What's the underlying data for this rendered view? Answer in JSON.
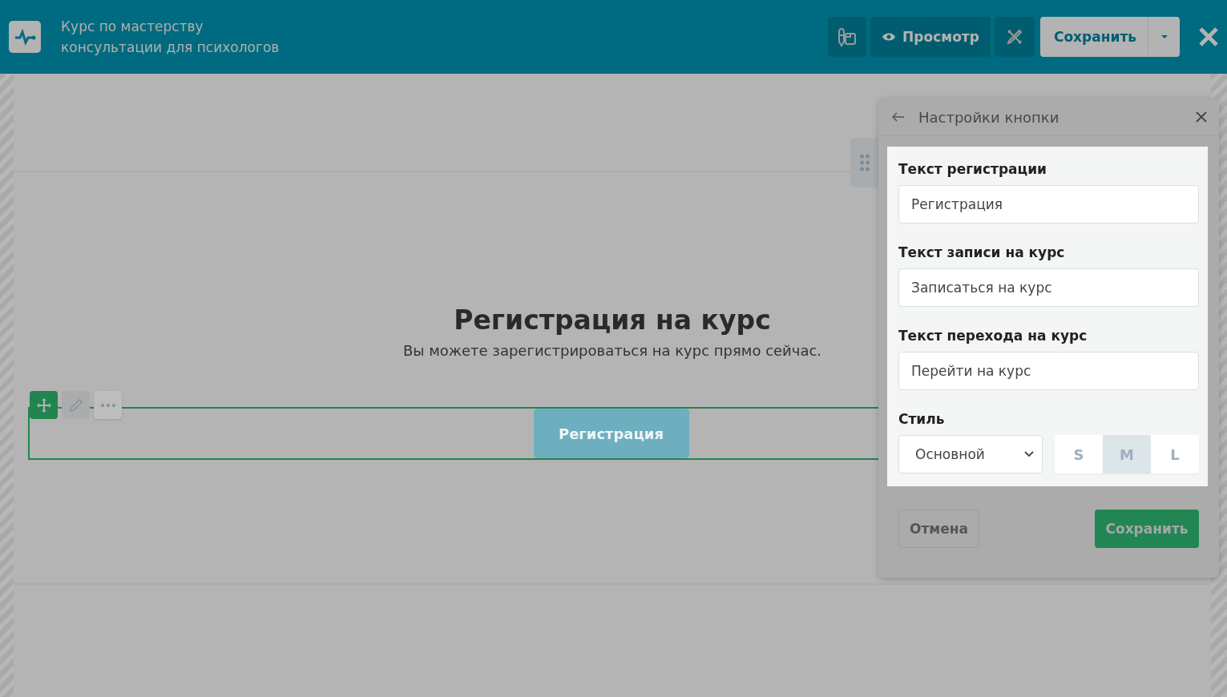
{
  "header": {
    "title_line_1": "Курс по мастерству",
    "title_line_2": "консультации для психологов",
    "preview_button": "Просмотр",
    "save_button": "Сохранить"
  },
  "canvas": {
    "heading": "Регистрация на курс",
    "subtitle": "Вы можете зарегистрироваться на курс прямо сейчас.",
    "block_button": "Регистрация",
    "block_selected": true
  },
  "panel": {
    "title": "Настройки кнопки",
    "fields": [
      {
        "label": "Текст регистрации",
        "value": "Регистрация"
      },
      {
        "label": "Текст записи на курс",
        "value": "Записаться на курс"
      },
      {
        "label": "Текст перехода на курс",
        "value": "Перейти на курс"
      }
    ],
    "style_label": "Стиль",
    "style_value": "Основной",
    "sizes": [
      {
        "label": "S",
        "selected": false
      },
      {
        "label": "M",
        "selected": true
      },
      {
        "label": "L",
        "selected": false
      }
    ],
    "cancel_button": "Отмена",
    "save_button": "Сохранить"
  }
}
